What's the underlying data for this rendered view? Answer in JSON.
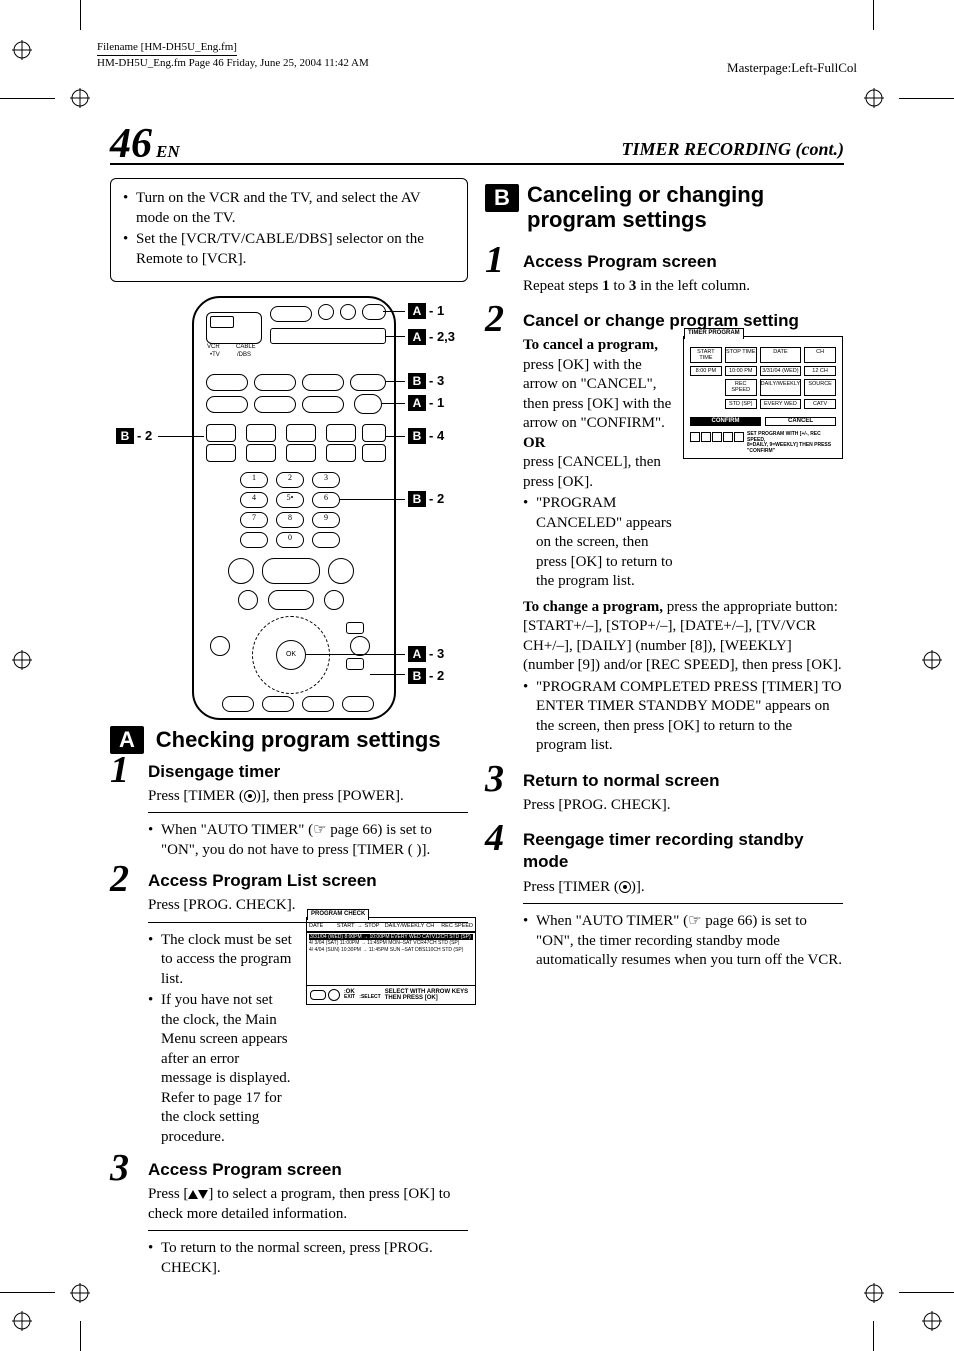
{
  "file": {
    "filename_label": "Filename [HM-DH5U_Eng.fm]",
    "saveline": "HM-DH5U_Eng.fm  Page 46  Friday, June 25, 2004  11:42 AM",
    "masterpage": "Masterpage:Left-FullCol"
  },
  "header": {
    "page": "46",
    "page_lang": "EN",
    "section": "TIMER RECORDING (cont.)"
  },
  "intro": {
    "items": [
      "Turn on the VCR and the TV, and select the AV mode on the TV.",
      "Set the [VCR/TV/CABLE/DBS] selector on the Remote to [VCR]."
    ]
  },
  "remote": {
    "switch": {
      "vcr": "VCR",
      "cable": "CABLE",
      "tv": "•TV",
      "dbs": "/DBS"
    },
    "labels": {
      "a1_top": "- 1",
      "a23": "- 2,3",
      "b3": "- 3",
      "a1_mid": "- 1",
      "b4": "- 4",
      "b2_left": "- 2",
      "b2_mid": "- 2",
      "a3": "- 3",
      "b2_bot": "- 2"
    }
  },
  "sectionA": {
    "letter": "A",
    "title": "Checking program settings",
    "s1": {
      "num": "1",
      "title": "Disengage timer",
      "body": "Press [TIMER ( )], then press [POWER].",
      "note": "When \"AUTO TIMER\" (☞ page 66) is set to \"ON\", you do not have to press [TIMER ( )]."
    },
    "s2": {
      "num": "2",
      "title": "Access Program List screen",
      "body": "Press [PROG. CHECK].",
      "notes": [
        "The clock must be set to access the program list.",
        "If you have not set the clock, the Main Menu screen appears after an error message is displayed. Refer to page 17 for the clock setting procedure."
      ],
      "progcheck": {
        "tab": "PROGRAM CHECK",
        "hdr": [
          "DATE",
          "START",
          "STOP",
          "DAILY/WEEKLY",
          "CH",
          "REC SPEED"
        ],
        "rows": [
          "3/31/04 (WED)  8:00PM → 10:00PM  EVERY WED  CATV12CH   STD (SP)",
          "4/  3/04 (SAT) 11:00PM → 11:45PM  MON–SAT   VCR47CH   STD (SP)",
          "4/  4/04 (SUN) 10:30PM → 11:45PM  SUN –SAT  DBS110CH  STD (SP)"
        ],
        "footer_ok": "OK",
        "footer_exit": "EXIT",
        "footer_sel": "SELECT",
        "footer_hint1": "SELECT WITH ARROW KEYS",
        "footer_hint2": "THEN PRESS [OK]"
      }
    },
    "s3": {
      "num": "3",
      "title": "Access Program screen",
      "body": "Press [  ] to select a program, then press [OK] to check more detailed information.",
      "note": "To return to the normal screen, press [PROG. CHECK]."
    }
  },
  "sectionB": {
    "letter": "B",
    "title": "Canceling or changing program settings",
    "s1": {
      "num": "1",
      "title": "Access Program screen",
      "body_pre": "Repeat steps ",
      "body_b1": "1",
      "body_mid": " to ",
      "body_b3": "3",
      "body_post": " in the left column."
    },
    "s2": {
      "num": "2",
      "title": "Cancel or change program setting",
      "cancel_lead": "To cancel a program,",
      "cancel_body": "press [OK] with the arrow on \"CANCEL\", then press [OK] with the arrow on \"CONFIRM\".",
      "or": "OR",
      "or_body": "press [CANCEL],  then press [OK].",
      "cancel_note": "\"PROGRAM CANCELED\" appears on the screen, then press [OK] to return to the program list.",
      "change_lead": "To change a program,",
      "change_body": " press the appropriate button: [START+/–], [STOP+/–], [DATE+/–], [TV/VCR CH+/–], [DAILY] (number [8]), [WEEKLY] (number [9]) and/or [REC SPEED], then press [OK].",
      "change_note": "\"PROGRAM COMPLETED PRESS [TIMER] TO ENTER TIMER STANDBY MODE\" appears on the screen, then press [OK] to return to the program list.",
      "timerbox": {
        "tab": "TIMER PROGRAM",
        "hdrs": [
          "START TIME",
          "STOP TIME",
          "DATE",
          "CH"
        ],
        "vals": [
          "8:00 PM",
          "10:00  PM",
          "3/31/04 (WED)",
          "12 CH"
        ],
        "hdrs2": [
          "REC SPEED",
          "DAILY/WEEKLY",
          "SOURCE"
        ],
        "vals2": [
          "STD (SP)",
          "EVERY WED",
          "CATV"
        ],
        "confirm": "CONFIRM",
        "cancel": "CANCEL",
        "ftr1": "SET PROGRAM WITH [+/-, REC SPEED,",
        "ftr2": "8=DAILY, 9=WEEKLY] THEN PRESS \"CONFIRM\""
      }
    },
    "s3": {
      "num": "3",
      "title": "Return to normal screen",
      "body": "Press [PROG. CHECK]."
    },
    "s4": {
      "num": "4",
      "title": "Reengage timer recording standby mode",
      "body": "Press [TIMER ( )].",
      "note": "When \"AUTO TIMER\" (☞ page 66) is set to \"ON\", the timer recording standby mode automatically resumes when you turn off the VCR."
    }
  }
}
